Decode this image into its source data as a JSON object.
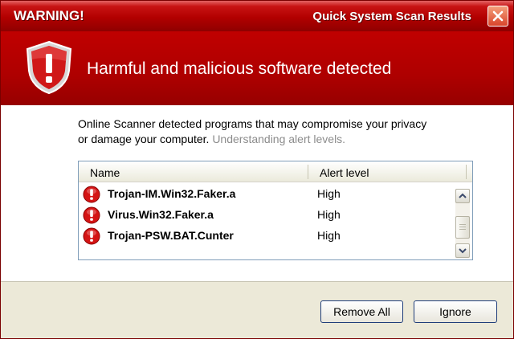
{
  "window": {
    "title_left": "WARNING!",
    "title_right": "Quick System Scan Results"
  },
  "banner": {
    "headline": "Harmful and malicious software detected"
  },
  "content": {
    "description": "Online Scanner detected programs that may compromise your privacy or damage your computer.",
    "link_text": "Understanding alert levels."
  },
  "list": {
    "columns": [
      "Name",
      "Alert level"
    ],
    "rows": [
      {
        "name": "Trojan-IM.Win32.Faker.a",
        "level": "High"
      },
      {
        "name": "Virus.Win32.Faker.a",
        "level": "High"
      },
      {
        "name": "Trojan-PSW.BAT.Cunter",
        "level": "High"
      }
    ]
  },
  "buttons": {
    "remove_all": "Remove All",
    "ignore": "Ignore"
  },
  "colors": {
    "title_bar": "#b20000",
    "banner": "#ae0000",
    "alert_icon": "#d41414"
  },
  "icons": {
    "close": "close-icon",
    "shield": "shield-exclamation-icon",
    "row": "exclamation-circle-icon"
  }
}
